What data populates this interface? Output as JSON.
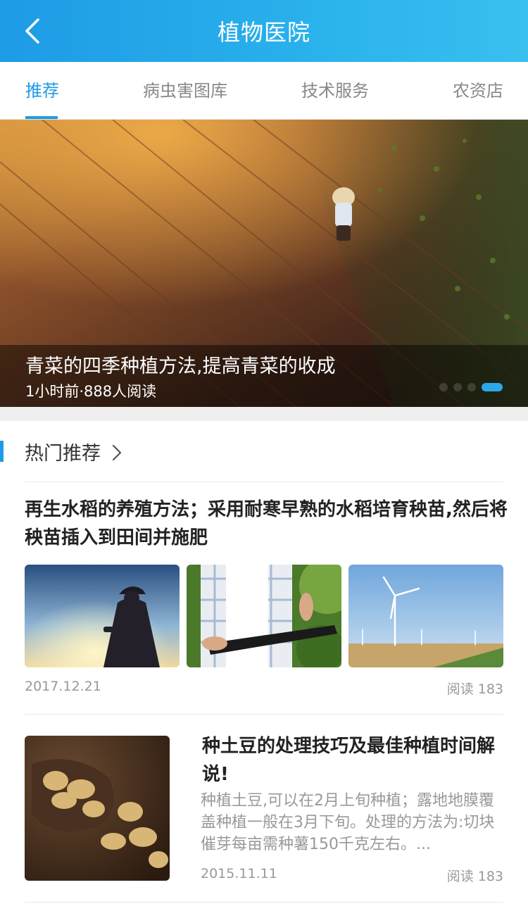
{
  "header": {
    "title": "植物医院",
    "back_icon": "chevron-left-icon"
  },
  "tabs": [
    {
      "label": "推荐",
      "active": true
    },
    {
      "label": "病虫害图库",
      "active": false
    },
    {
      "label": "技术服务",
      "active": false
    },
    {
      "label": "农资店",
      "active": false
    }
  ],
  "banner": {
    "title": "青菜的四季种植方法,提高青菜的收成",
    "meta": "1小时前·888人阅读",
    "slide_count": 4,
    "active_slide": 4
  },
  "section": {
    "title": "热门推荐",
    "arrow_icon": "chevron-right-icon"
  },
  "articles": [
    {
      "title": "再生水稻的养殖方法；采用耐寒早熟的水稻培育秧苗,然后将秧苗插入到田间并施肥",
      "images": [
        "farmer-silhouette-sunset",
        "tablet-in-crop-field",
        "wind-turbines-field"
      ],
      "date": "2017.12.21",
      "reads": "阅读 183"
    },
    {
      "title": "种土豆的处理技巧及最佳种植时间解说!",
      "summary": "种植土豆,可以在2月上旬种植；露地地膜覆盖种植一般在3月下旬。处理的方法为:切块催芽每亩需种薯150千克左右。...",
      "image": "potatoes-in-bowl",
      "date": "2015.11.11",
      "reads": "阅读 183"
    }
  ],
  "colors": {
    "accent": "#1e9be6",
    "header_end": "#39c0ef",
    "muted": "#999999"
  }
}
